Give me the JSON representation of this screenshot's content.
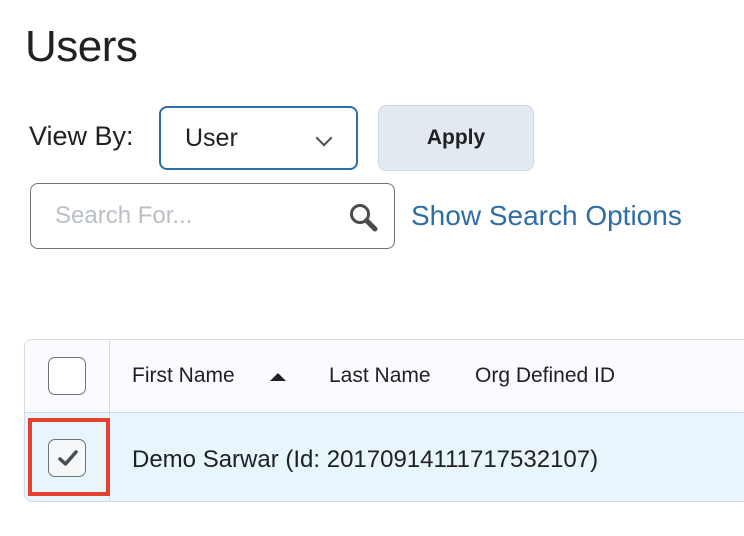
{
  "page": {
    "title": "Users"
  },
  "filter": {
    "view_by_label": "View By:",
    "view_by_value": "User",
    "apply_label": "Apply"
  },
  "search": {
    "placeholder": "Search For...",
    "value": "",
    "show_options_label": "Show Search Options"
  },
  "table": {
    "columns": [
      "First Name",
      "Last Name",
      "Org Defined ID"
    ],
    "sort": {
      "column": "First Name",
      "direction": "ascending"
    },
    "rows": [
      {
        "name": "Demo Sarwar (Id: 20170914111717532107)",
        "selected": true
      }
    ]
  },
  "colors": {
    "link": "#2f6ea5",
    "selected_row": "#e8f5fd",
    "highlight": "#e4412f",
    "button_bg": "#e3e9f1"
  },
  "icons": {
    "select": "chevron-down-icon",
    "search": "search-icon",
    "sort": "sort-ascending-icon",
    "check": "checkmark-icon"
  }
}
